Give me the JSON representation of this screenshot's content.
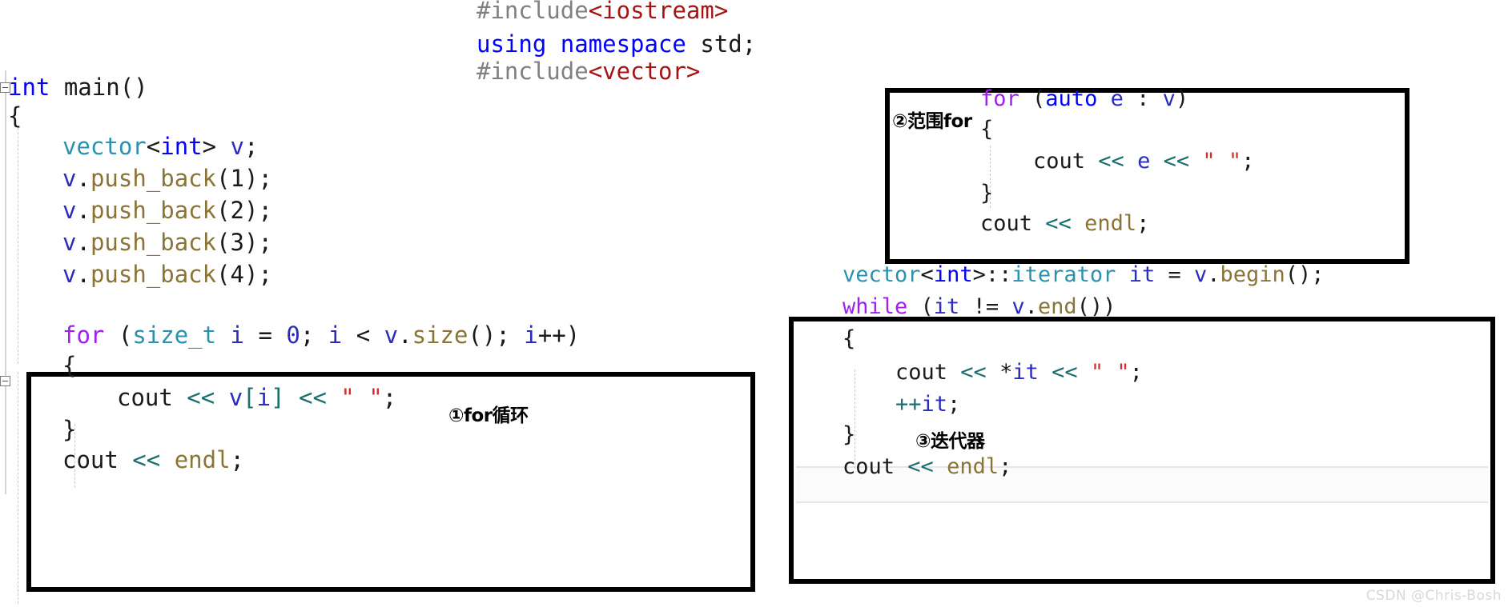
{
  "editor": {
    "language": "C++",
    "background_color": "#ffffff",
    "gutter": {
      "collapse_main_glyph": "−",
      "collapse_for_glyph": "−"
    }
  },
  "colors": {
    "preprocessor": "#808080",
    "header_name": "#a31515",
    "keyword": "#0000ff",
    "type": "#2b91af",
    "function": "#8a7436",
    "variable": "#2b2bbe",
    "control_keyword": "#a020f0",
    "operator": "#1b6f6f",
    "string": "#d42b2b",
    "plain": "#1a1a1a",
    "box_border": "#000000",
    "watermark": "#d8d8d8"
  },
  "header_block": {
    "line1": {
      "pre": "#include",
      "header": "<iostream>"
    },
    "line2": {
      "kw": "using namespace ",
      "plain": "std;"
    },
    "line3": {
      "pre": "#include",
      "header": "<vector>"
    }
  },
  "main_block": {
    "line_int_main": {
      "kw": "int",
      "plain": " main()"
    },
    "line_open_brace": "{",
    "line_vector_decl": {
      "type": "vector",
      "lt": "<",
      "kw": "int",
      "gt": "> ",
      "var": "v",
      "plain": ";"
    },
    "push_backs": [
      {
        "var": "v",
        "dot": ".",
        "fn": "push_back",
        "open": "(",
        "num": "1",
        "close": ");"
      },
      {
        "var": "v",
        "dot": ".",
        "fn": "push_back",
        "open": "(",
        "num": "2",
        "close": ");"
      },
      {
        "var": "v",
        "dot": ".",
        "fn": "push_back",
        "open": "(",
        "num": "3",
        "close": ");"
      },
      {
        "var": "v",
        "dot": ".",
        "fn": "push_back",
        "open": "(",
        "num": "4",
        "close": ");"
      }
    ]
  },
  "box1": {
    "label": "①for循环",
    "lines": {
      "for_header": {
        "ctl": "for",
        "p1": " (",
        "type": "size_t",
        "p2": " ",
        "var_i": "i",
        "p3": " = ",
        "num0": "0",
        "p4": "; ",
        "var_i2": "i",
        "p5": " < ",
        "var_v": "v",
        "p6": ".",
        "fn": "size",
        "p7": "(); ",
        "var_i3": "i",
        "op": "++",
        "p8": ")"
      },
      "open_brace": "{",
      "cout_line": {
        "cout": "cout",
        "op1": " << ",
        "var_v": "v",
        "br_open": "[",
        "var_i": "i",
        "br_close": "]",
        "op2": " << ",
        "str": "\" \"",
        "semi": ";"
      },
      "close_brace": "}",
      "cout_endl": {
        "cout": "cout",
        "op": " << ",
        "fn": "endl",
        "semi": ";"
      }
    }
  },
  "box2": {
    "label": "②范围for",
    "lines": {
      "for_header": {
        "ctl": "for",
        "p1": " (",
        "kw": "auto",
        "p2": " ",
        "var_e": "e",
        "p3": " : ",
        "var_v": "v",
        "p4": ")"
      },
      "open_brace": "{",
      "cout_line": {
        "cout": "cout",
        "op1": " << ",
        "var_e": "e",
        "op2": " << ",
        "str": "\" \"",
        "semi": ";"
      },
      "close_brace": "}",
      "cout_endl": {
        "cout": "cout",
        "op": " << ",
        "fn": "endl",
        "semi": ";"
      }
    }
  },
  "box3": {
    "label": "③迭代器",
    "lines": {
      "iter_decl": {
        "type": "vector",
        "lt": "<",
        "kw": "int",
        "gt": ">",
        "scope": "::",
        "type2": "iterator",
        "sp": " ",
        "var_it": "it",
        "eq": " = ",
        "var_v": "v",
        "dot": ".",
        "fn": "begin",
        "tail": "();"
      },
      "while_header": {
        "ctl": "while",
        "p1": " (",
        "var_it": "it",
        "neq": " != ",
        "var_v": "v",
        "dot": ".",
        "fn": "end",
        "tail": "())"
      },
      "open_brace": "{",
      "cout_line": {
        "cout": "cout",
        "op1": " << ",
        "star": "*",
        "var_it": "it",
        "op2": " << ",
        "str": "\" \"",
        "semi": ";"
      },
      "inc_line": {
        "op": "++",
        "var_it": "it",
        "semi": ";"
      },
      "close_brace": "}",
      "cout_endl": {
        "cout": "cout",
        "op": " << ",
        "fn": "endl",
        "semi": ";"
      }
    }
  },
  "watermark": {
    "text": "CSDN @Chris-Bosh"
  }
}
